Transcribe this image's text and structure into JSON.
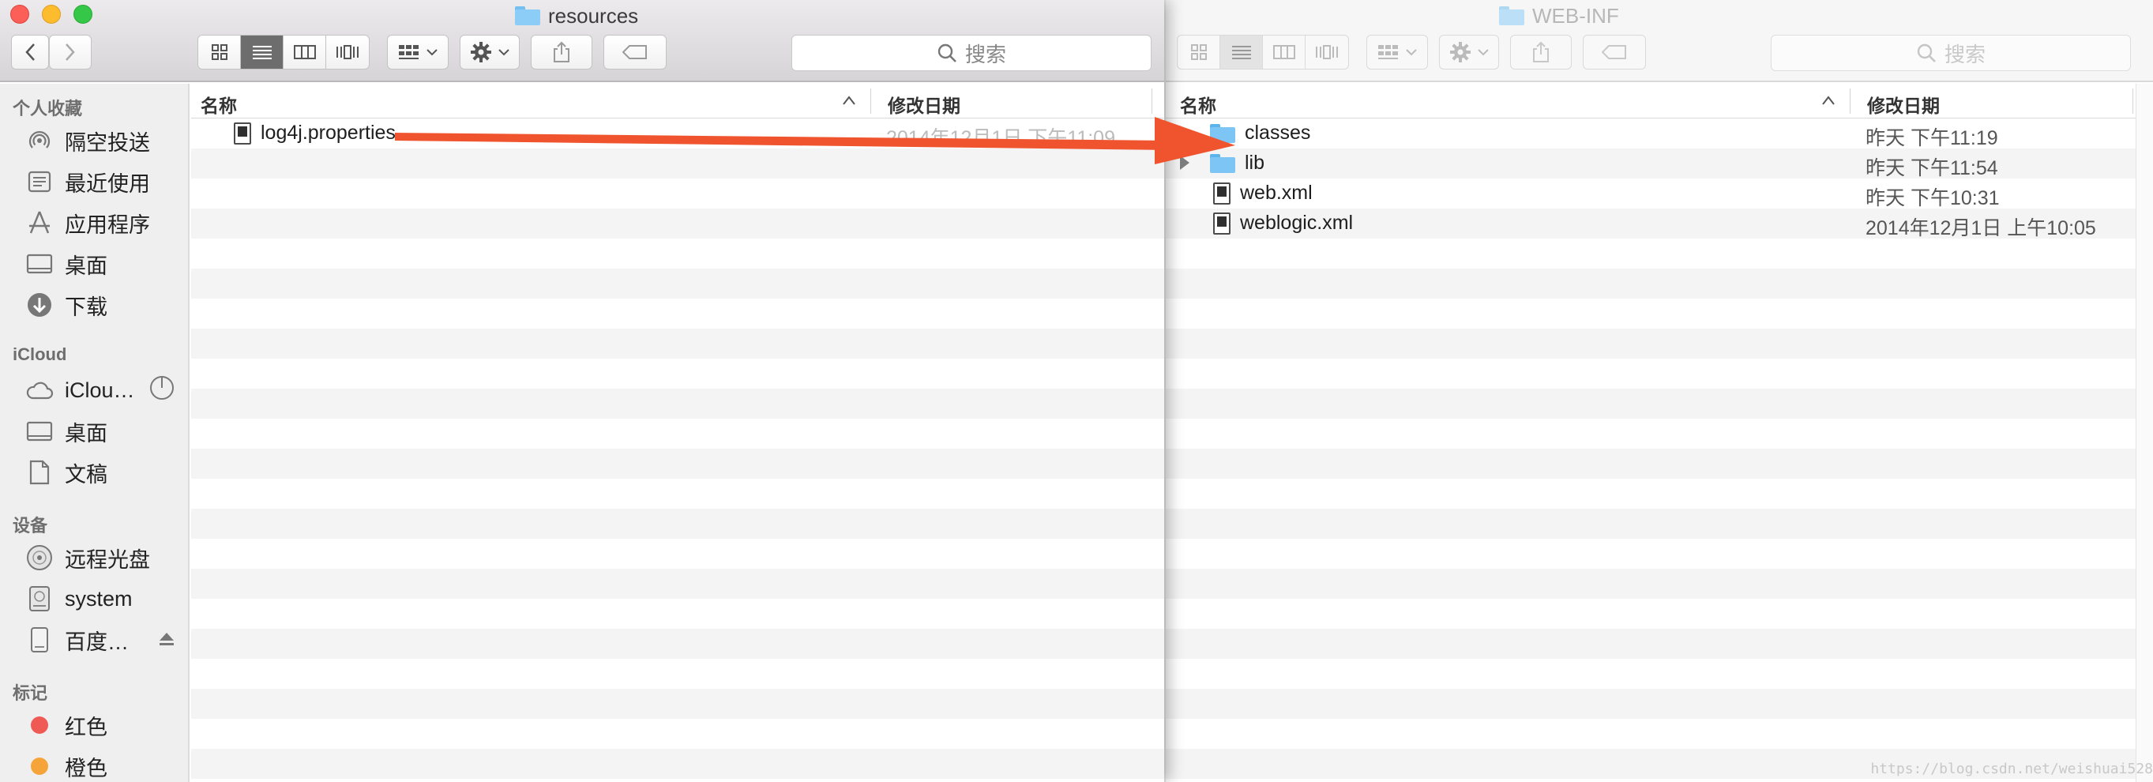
{
  "left_window": {
    "title": "resources",
    "sidebar": {
      "favorites_heading": "个人收藏",
      "favorites": [
        {
          "label": "隔空投送",
          "icon": "airdrop-icon"
        },
        {
          "label": "最近使用",
          "icon": "recents-icon"
        },
        {
          "label": "应用程序",
          "icon": "applications-icon"
        },
        {
          "label": "桌面",
          "icon": "desktop-icon"
        },
        {
          "label": "下载",
          "icon": "downloads-icon"
        }
      ],
      "icloud_heading": "iCloud",
      "icloud": [
        {
          "label": "iClou…",
          "icon": "icloud-icon"
        },
        {
          "label": "桌面",
          "icon": "desktop-icon"
        },
        {
          "label": "文稿",
          "icon": "documents-icon"
        }
      ],
      "devices_heading": "设备",
      "devices": [
        {
          "label": "远程光盘",
          "icon": "remote-disc-icon"
        },
        {
          "label": "system",
          "icon": "disk-icon"
        },
        {
          "label": "百度…",
          "icon": "drive-icon"
        }
      ],
      "tags_heading": "标记",
      "tags": [
        {
          "label": "红色",
          "color": "#f05a55"
        },
        {
          "label": "橙色",
          "color": "#f5a43a"
        }
      ]
    },
    "search_placeholder": "搜索",
    "columns": {
      "name": "名称",
      "date": "修改日期"
    },
    "files": [
      {
        "name": "log4j.properties",
        "date": "2014年12月1日 下午11:09"
      }
    ]
  },
  "right_window": {
    "title": "WEB-INF",
    "search_placeholder": "搜索",
    "columns": {
      "name": "名称",
      "date": "修改日期"
    },
    "files": [
      {
        "name": "classes",
        "type": "folder",
        "date": "昨天 下午11:19"
      },
      {
        "name": "lib",
        "type": "folder",
        "date": "昨天 下午11:54"
      },
      {
        "name": "web.xml",
        "type": "file",
        "date": "昨天 下午10:31"
      },
      {
        "name": "weblogic.xml",
        "type": "file",
        "date": "2014年12月1日 上午10:05"
      }
    ]
  },
  "annotation": {
    "arrow_color": "#f0542e"
  },
  "watermark": "https://blog.csdn.net/weishuai528"
}
